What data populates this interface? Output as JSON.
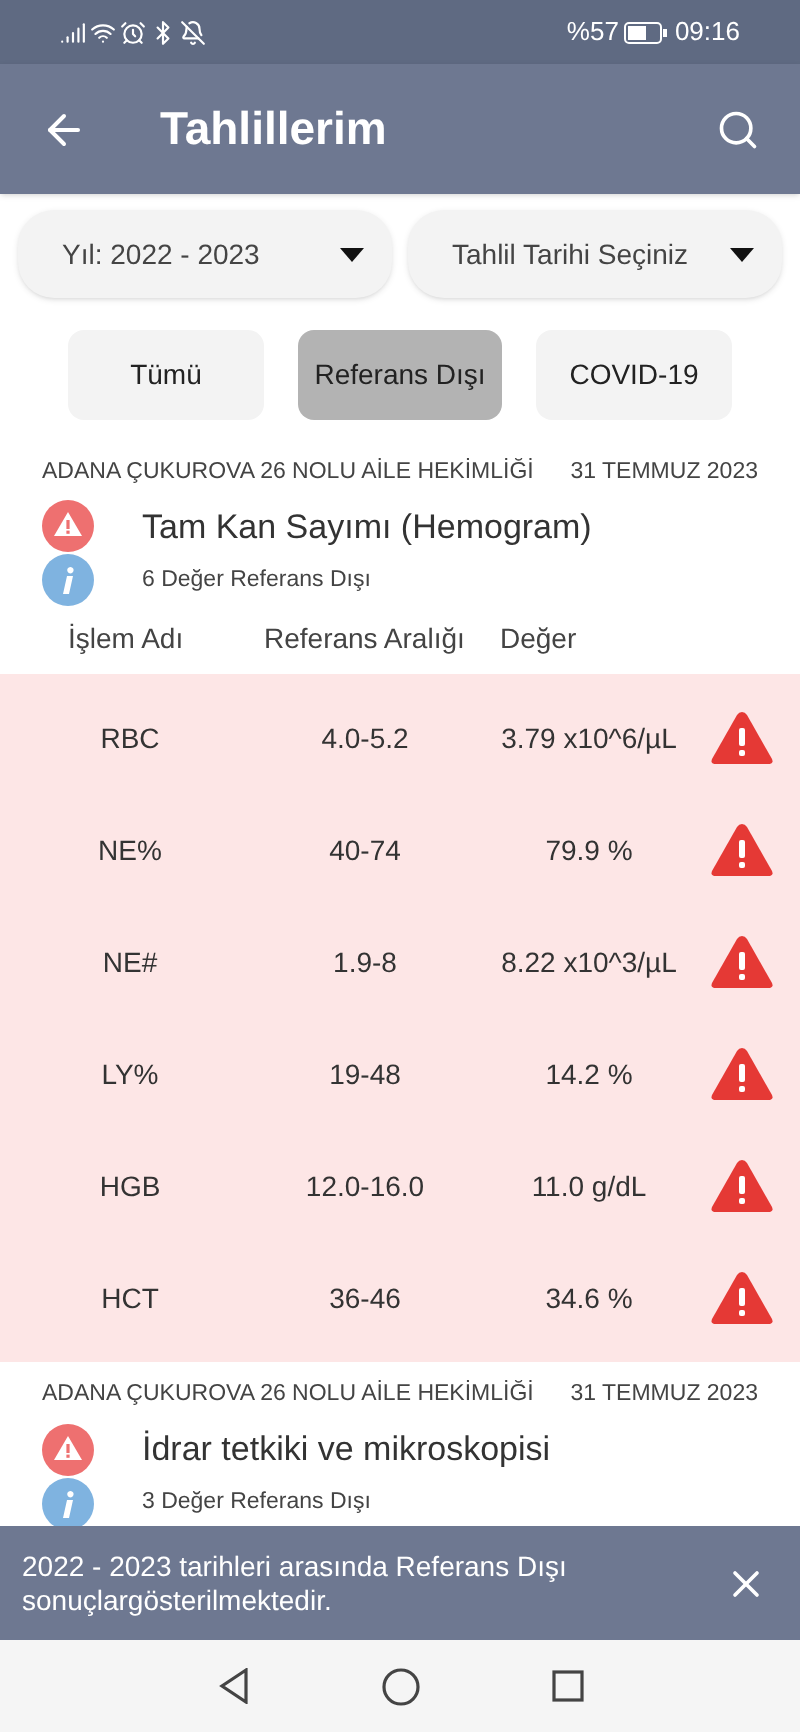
{
  "status_bar": {
    "battery": "%57",
    "time": "09:16"
  },
  "app_bar": {
    "title": "Tahlillerim"
  },
  "filters": [
    {
      "value": "Yıl: 2022 - 2023"
    },
    {
      "value": "Tahlil Tarihi Seçiniz"
    }
  ],
  "chips": [
    {
      "label": "Tümü",
      "selected": false
    },
    {
      "label": "Referans Dışı",
      "selected": true
    },
    {
      "label": "COVID-19",
      "selected": false
    }
  ],
  "results": [
    {
      "clinic": "ADANA ÇUKUROVA 26 NOLU AİLE HEKİMLİĞİ",
      "date": "31 TEMMUZ 2023",
      "title": "Tam Kan Sayımı (Hemogram)",
      "info": "6 Değer Referans Dışı",
      "columns": [
        "İşlem Adı",
        "Referans Aralığı",
        "Değer"
      ],
      "rows": [
        {
          "name": "RBC",
          "range": "4.0-5.2",
          "value": "3.79 x10^6/µL",
          "out_of_range": true
        },
        {
          "name": "NE%",
          "range": "40-74",
          "value": "79.9 %",
          "out_of_range": true
        },
        {
          "name": "NE#",
          "range": "1.9-8",
          "value": "8.22 x10^3/µL",
          "out_of_range": true
        },
        {
          "name": "LY%",
          "range": "19-48",
          "value": "14.2 %",
          "out_of_range": true
        },
        {
          "name": "HGB",
          "range": "12.0-16.0",
          "value": "11.0 g/dL",
          "out_of_range": true
        },
        {
          "name": "HCT",
          "range": "36-46",
          "value": "34.6 %",
          "out_of_range": true
        }
      ]
    },
    {
      "clinic": "ADANA ÇUKUROVA 26 NOLU AİLE HEKİMLİĞİ",
      "date": "31 TEMMUZ 2023",
      "title": "İdrar tetkiki ve mikroskopisi",
      "info": "3 Değer Referans Dışı"
    }
  ],
  "snackbar": {
    "message": "2022 - 2023 tarihleri arasında Referans Dışı sonuçlargösterilmektedir."
  }
}
